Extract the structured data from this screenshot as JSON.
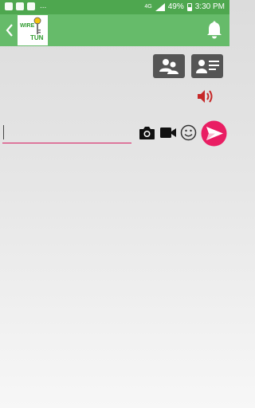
{
  "status_bar": {
    "ellipsis": "...",
    "network": "4G",
    "battery": "49%",
    "time": "3:30 PM"
  },
  "app_bar": {
    "logo_top": "WIRE",
    "logo_bottom": "TUN"
  },
  "composer": {
    "message_value": "",
    "message_placeholder": ""
  },
  "icons": {
    "back": "chevron-left",
    "bell": "bell",
    "contacts": "group",
    "contact_list": "person-with-lines",
    "speaker": "volume-up",
    "camera": "camera",
    "video": "videocam",
    "emoji": "smiley",
    "send": "send"
  },
  "colors": {
    "status_bar": "#4ea74f",
    "app_bar": "#66bb6a",
    "accent_pink": "#e91e63",
    "speaker_red": "#c62828",
    "button_dark": "#555555"
  }
}
